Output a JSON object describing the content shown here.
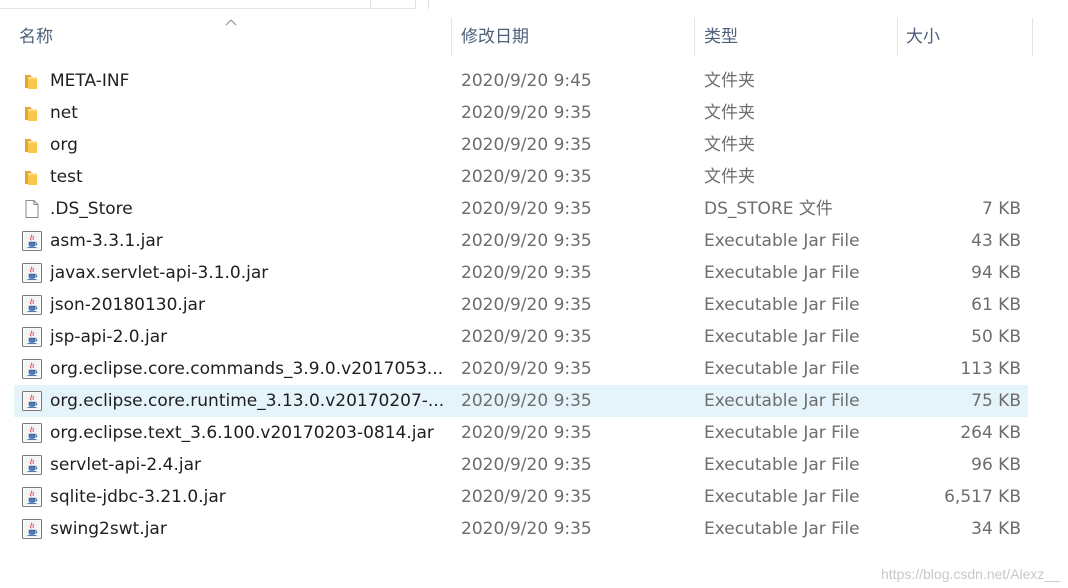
{
  "columns": {
    "name": "名称",
    "date": "修改日期",
    "type": "类型",
    "size": "大小"
  },
  "sort": {
    "column": "name",
    "direction": "ascending",
    "icon": "chevron-up-icon"
  },
  "files": [
    {
      "icon": "folder-icon",
      "name": "META-INF",
      "date": "2020/9/20 9:45",
      "type": "文件夹",
      "size": ""
    },
    {
      "icon": "folder-icon",
      "name": "net",
      "date": "2020/9/20 9:35",
      "type": "文件夹",
      "size": ""
    },
    {
      "icon": "folder-icon",
      "name": "org",
      "date": "2020/9/20 9:35",
      "type": "文件夹",
      "size": ""
    },
    {
      "icon": "folder-icon",
      "name": "test",
      "date": "2020/9/20 9:35",
      "type": "文件夹",
      "size": ""
    },
    {
      "icon": "file-icon",
      "name": ".DS_Store",
      "date": "2020/9/20 9:35",
      "type": "DS_STORE 文件",
      "size": "7 KB"
    },
    {
      "icon": "java-jar-icon",
      "name": "asm-3.3.1.jar",
      "date": "2020/9/20 9:35",
      "type": "Executable Jar File",
      "size": "43 KB"
    },
    {
      "icon": "java-jar-icon",
      "name": "javax.servlet-api-3.1.0.jar",
      "date": "2020/9/20 9:35",
      "type": "Executable Jar File",
      "size": "94 KB"
    },
    {
      "icon": "java-jar-icon",
      "name": "json-20180130.jar",
      "date": "2020/9/20 9:35",
      "type": "Executable Jar File",
      "size": "61 KB"
    },
    {
      "icon": "java-jar-icon",
      "name": "jsp-api-2.0.jar",
      "date": "2020/9/20 9:35",
      "type": "Executable Jar File",
      "size": "50 KB"
    },
    {
      "icon": "java-jar-icon",
      "name": "org.eclipse.core.commands_3.9.0.v2017053...",
      "date": "2020/9/20 9:35",
      "type": "Executable Jar File",
      "size": "113 KB"
    },
    {
      "icon": "java-jar-icon",
      "name": "org.eclipse.core.runtime_3.13.0.v20170207-...",
      "date": "2020/9/20 9:35",
      "type": "Executable Jar File",
      "size": "75 KB",
      "selected": true
    },
    {
      "icon": "java-jar-icon",
      "name": "org.eclipse.text_3.6.100.v20170203-0814.jar",
      "date": "2020/9/20 9:35",
      "type": "Executable Jar File",
      "size": "264 KB"
    },
    {
      "icon": "java-jar-icon",
      "name": "servlet-api-2.4.jar",
      "date": "2020/9/20 9:35",
      "type": "Executable Jar File",
      "size": "96 KB"
    },
    {
      "icon": "java-jar-icon",
      "name": "sqlite-jdbc-3.21.0.jar",
      "date": "2020/9/20 9:35",
      "type": "Executable Jar File",
      "size": "6,517 KB"
    },
    {
      "icon": "java-jar-icon",
      "name": "swing2swt.jar",
      "date": "2020/9/20 9:35",
      "type": "Executable Jar File",
      "size": "34 KB"
    }
  ],
  "watermark": "https://blog.csdn.net/Alexz__",
  "colors": {
    "header_text": "#4c607a",
    "selected_row": "#e5f3fb",
    "folder": "#f4c13e",
    "secondary_text": "#6d6d6d"
  }
}
